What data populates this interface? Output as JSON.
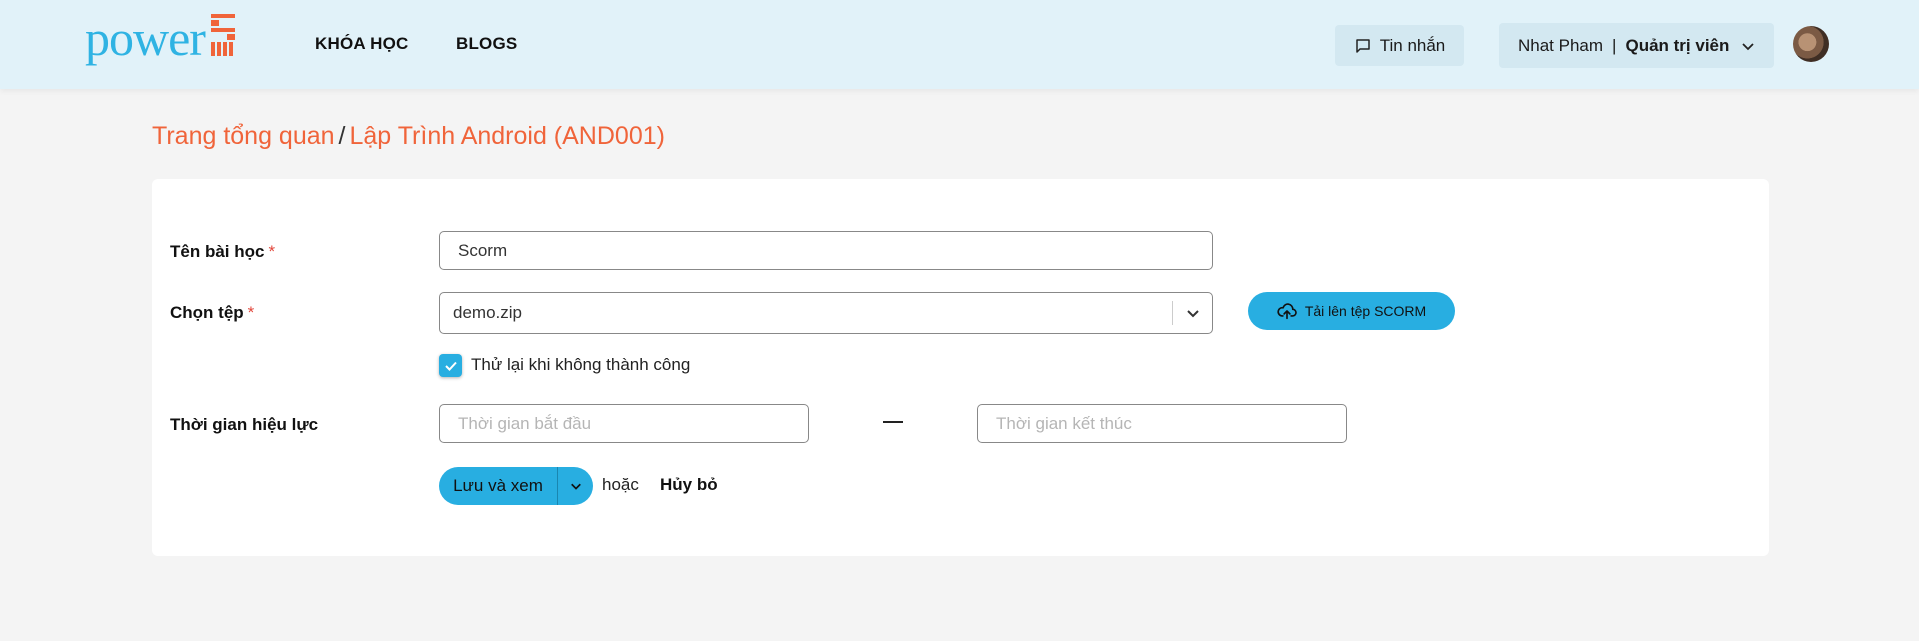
{
  "header": {
    "logo_text": "power",
    "nav": [
      {
        "label": "KHÓA HỌC"
      },
      {
        "label": "BLOGS"
      }
    ],
    "messages_label": "Tin nhắn",
    "user_name": "Nhat Pham",
    "user_separator": "|",
    "user_role": "Quản trị viên"
  },
  "breadcrumb": {
    "home": "Trang tổng quan",
    "separator": "/",
    "current": "Lập Trình Android (AND001)"
  },
  "form": {
    "lesson_name_label": "Tên bài học",
    "required_mark": "*",
    "lesson_name_value": "Scorm",
    "file_label": "Chọn tệp",
    "file_value": "demo.zip",
    "upload_label": "Tải lên tệp SCORM",
    "retry_label": "Thử lại khi không thành công",
    "retry_checked": true,
    "validity_label": "Thời gian hiệu lực",
    "start_placeholder": "Thời gian bắt đầu",
    "end_placeholder": "Thời gian kết thúc",
    "save_label": "Lưu và xem",
    "or_text": "hoặc",
    "cancel_label": "Hủy bỏ"
  },
  "colors": {
    "header_bg": "#e1f2f9",
    "accent": "#28aee1",
    "breadcrumb": "#f0643a",
    "logo_blue": "#2fb3e3",
    "logo_orange": "#f0643a",
    "required": "#e2463b"
  }
}
